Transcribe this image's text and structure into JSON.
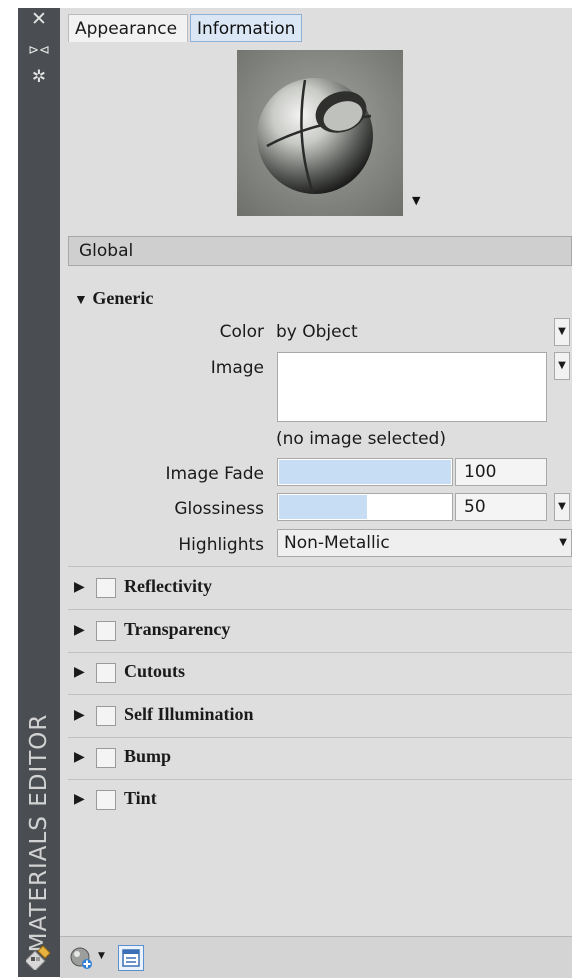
{
  "sidebar": {
    "title": "MATERIALS EDITOR",
    "icons": [
      "close-icon",
      "auto-hide-icon",
      "properties-icon",
      "materials-editor-icon"
    ]
  },
  "tabs": [
    {
      "label": "Appearance",
      "active": true
    },
    {
      "label": "Information",
      "active": false
    }
  ],
  "global_label": "Global",
  "generic": {
    "header": "Generic",
    "color_label": "Color",
    "color_value": "by Object",
    "image_label": "Image",
    "image_status": "(no image selected)",
    "image_fade_label": "Image Fade",
    "image_fade_value": "100",
    "image_fade_level": 100,
    "glossiness_label": "Glossiness",
    "glossiness_value": "50",
    "glossiness_level": 50,
    "highlights_label": "Highlights",
    "highlights_value": "Non-Metallic"
  },
  "collapsed_sections": [
    {
      "label": "Reflectivity",
      "checked": false
    },
    {
      "label": "Transparency",
      "checked": false
    },
    {
      "label": "Cutouts",
      "checked": false
    },
    {
      "label": "Self Illumination",
      "checked": false
    },
    {
      "label": "Bump",
      "checked": false
    },
    {
      "label": "Tint",
      "checked": false
    }
  ],
  "bottom_toolbar": {
    "icons": [
      "create-material-icon",
      "chevron-down-icon",
      "material-browser-icon"
    ]
  },
  "colors": {
    "sidebar_bg": "#4a4d51",
    "panel_bg": "#dedede",
    "slider_fill": "#c6ddf4",
    "tab_inactive_bg": "#dbe7f5"
  }
}
